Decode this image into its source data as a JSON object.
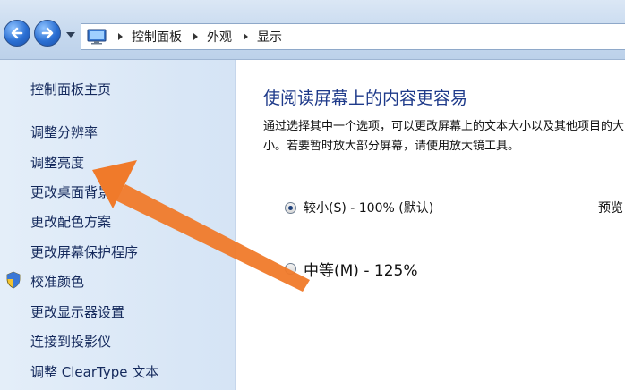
{
  "breadcrumb": {
    "items": [
      "控制面板",
      "外观",
      "显示"
    ]
  },
  "sidebar": {
    "items": [
      {
        "label": "控制面板主页"
      },
      {
        "label": "调整分辨率"
      },
      {
        "label": "调整亮度"
      },
      {
        "label": "更改桌面背景"
      },
      {
        "label": "更改配色方案"
      },
      {
        "label": "更改屏幕保护程序"
      },
      {
        "label": "校准颜色"
      },
      {
        "label": "更改显示器设置"
      },
      {
        "label": "连接到投影仪"
      },
      {
        "label": "调整 ClearType 文本"
      }
    ]
  },
  "main": {
    "title": "使阅读屏幕上的内容更容易",
    "description": "通过选择其中一个选项，可以更改屏幕上的文本大小以及其他项目的大小。若要暂时放大部分屏幕，请使用放大镜工具。",
    "options": [
      {
        "label": "较小(S) - 100% (默认)",
        "selected": true
      },
      {
        "label": "中等(M) - 125%",
        "selected": false
      }
    ],
    "preview_label": "预览"
  },
  "colors": {
    "link": "#14295c",
    "title": "#1e3a8a",
    "annotation_arrow": "#f07a2a"
  },
  "icons": [
    "back-arrow-icon",
    "forward-arrow-icon",
    "history-dropdown-icon",
    "control-panel-icon",
    "shield-icon",
    "chevron-right-icon"
  ]
}
